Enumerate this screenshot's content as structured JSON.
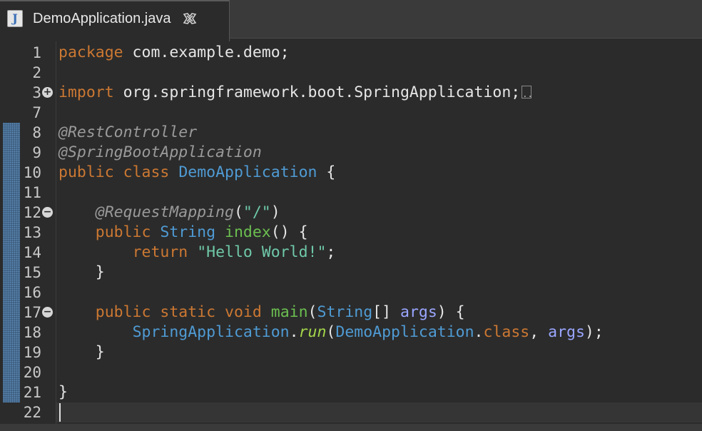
{
  "tab": {
    "filename": "DemoApplication.java",
    "icon": "java-file-icon",
    "close": "close-icon"
  },
  "code": {
    "line_numbers": [
      "1",
      "2",
      "3",
      "7",
      "8",
      "9",
      "10",
      "11",
      "12",
      "13",
      "14",
      "15",
      "16",
      "17",
      "18",
      "19",
      "20",
      "21",
      "22"
    ],
    "lines": [
      [
        {
          "c": "kw",
          "t": "package"
        },
        {
          "c": "pl",
          "t": " com.example.demo;"
        }
      ],
      [],
      [
        {
          "c": "kw",
          "t": "import"
        },
        {
          "c": "pl",
          "t": " org.springframework.boot.SpringApplication;"
        }
      ],
      [],
      [
        {
          "c": "ann",
          "t": "@RestController"
        }
      ],
      [
        {
          "c": "ann",
          "t": "@SpringBootApplication"
        }
      ],
      [
        {
          "c": "kw",
          "t": "public"
        },
        {
          "c": "pl",
          "t": " "
        },
        {
          "c": "kw",
          "t": "class"
        },
        {
          "c": "pl",
          "t": " "
        },
        {
          "c": "cls",
          "t": "DemoApplication"
        },
        {
          "c": "pl",
          "t": " {"
        }
      ],
      [],
      [
        {
          "c": "pl",
          "t": "    "
        },
        {
          "c": "ann",
          "t": "@RequestMapping"
        },
        {
          "c": "pl",
          "t": "("
        },
        {
          "c": "str",
          "t": "\"/\""
        },
        {
          "c": "pl",
          "t": ")"
        }
      ],
      [
        {
          "c": "pl",
          "t": "    "
        },
        {
          "c": "kw",
          "t": "public"
        },
        {
          "c": "pl",
          "t": " "
        },
        {
          "c": "cls",
          "t": "String"
        },
        {
          "c": "pl",
          "t": " "
        },
        {
          "c": "mth",
          "t": "index"
        },
        {
          "c": "pl",
          "t": "() {"
        }
      ],
      [
        {
          "c": "pl",
          "t": "        "
        },
        {
          "c": "kw",
          "t": "return"
        },
        {
          "c": "pl",
          "t": " "
        },
        {
          "c": "str",
          "t": "\"Hello World!\""
        },
        {
          "c": "pl",
          "t": ";"
        }
      ],
      [
        {
          "c": "pl",
          "t": "    }"
        }
      ],
      [],
      [
        {
          "c": "pl",
          "t": "    "
        },
        {
          "c": "kw",
          "t": "public"
        },
        {
          "c": "pl",
          "t": " "
        },
        {
          "c": "kw",
          "t": "static"
        },
        {
          "c": "pl",
          "t": " "
        },
        {
          "c": "kw",
          "t": "void"
        },
        {
          "c": "pl",
          "t": " "
        },
        {
          "c": "mth",
          "t": "main"
        },
        {
          "c": "pl",
          "t": "("
        },
        {
          "c": "cls",
          "t": "String"
        },
        {
          "c": "pl",
          "t": "[] "
        },
        {
          "c": "var",
          "t": "args"
        },
        {
          "c": "pl",
          "t": ") {"
        }
      ],
      [
        {
          "c": "pl",
          "t": "        "
        },
        {
          "c": "cls",
          "t": "SpringApplication"
        },
        {
          "c": "pl",
          "t": "."
        },
        {
          "c": "smth",
          "t": "run"
        },
        {
          "c": "pl",
          "t": "("
        },
        {
          "c": "cls",
          "t": "DemoApplication"
        },
        {
          "c": "pl",
          "t": "."
        },
        {
          "c": "kw",
          "t": "class"
        },
        {
          "c": "pl",
          "t": ", "
        },
        {
          "c": "var",
          "t": "args"
        },
        {
          "c": "pl",
          "t": ");"
        }
      ],
      [
        {
          "c": "pl",
          "t": "    }"
        }
      ],
      [],
      [
        {
          "c": "pl",
          "t": "}"
        }
      ],
      []
    ],
    "folds": {
      "2": "+",
      "8": "-",
      "13": "-"
    },
    "collapsed_marker_line": 2,
    "current_line_index": 18
  },
  "colors": {
    "keyword": "#cc7832",
    "annotation": "#9a9a9a",
    "class": "#4f9bd4",
    "string": "#6fc9a8",
    "method": "#6bbf50",
    "static_method": "#a4d64a",
    "variable": "#9aa6ff",
    "plain": "#e6e6e6",
    "background": "#2b2b2b"
  }
}
